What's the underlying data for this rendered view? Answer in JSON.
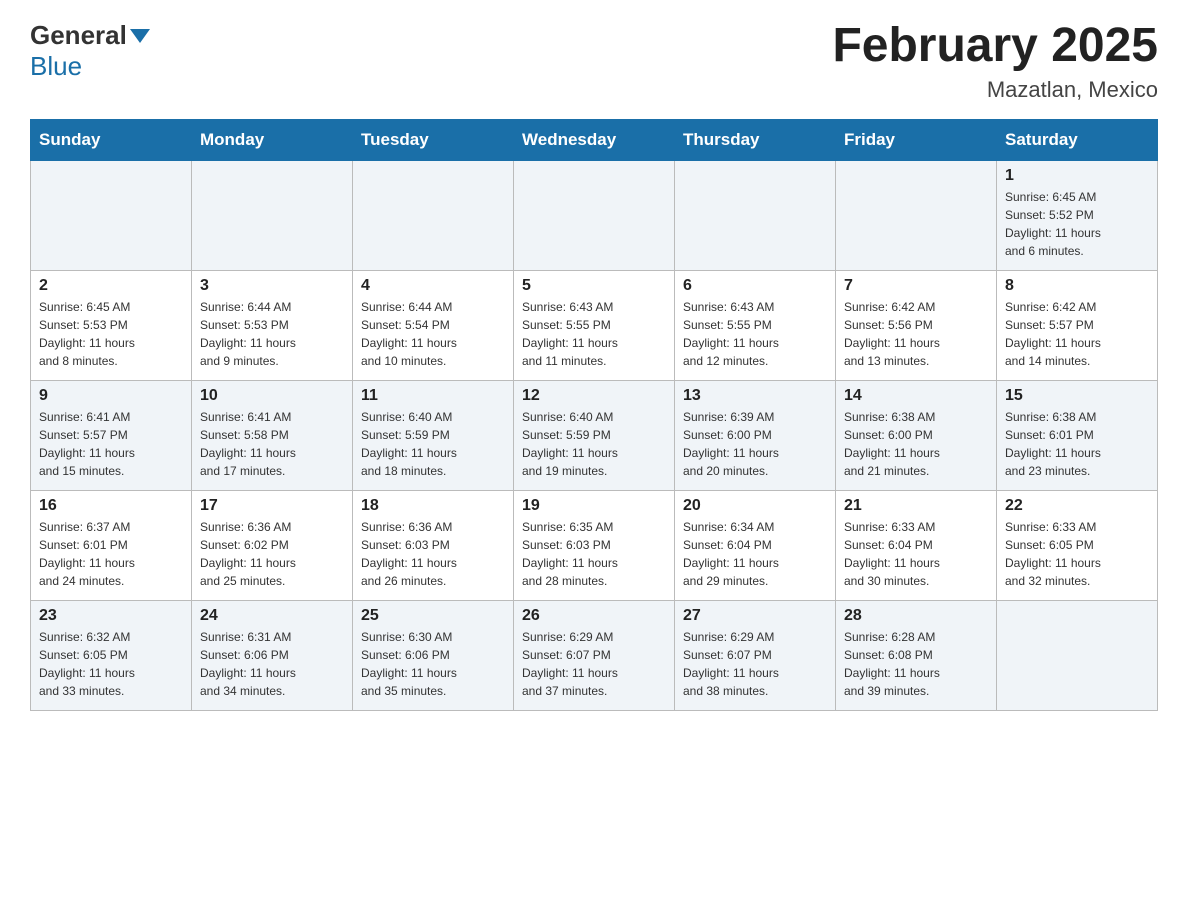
{
  "header": {
    "logo_general": "General",
    "logo_blue": "Blue",
    "month_title": "February 2025",
    "location": "Mazatlan, Mexico"
  },
  "days_of_week": [
    "Sunday",
    "Monday",
    "Tuesday",
    "Wednesday",
    "Thursday",
    "Friday",
    "Saturday"
  ],
  "weeks": [
    [
      {
        "day": "",
        "info": ""
      },
      {
        "day": "",
        "info": ""
      },
      {
        "day": "",
        "info": ""
      },
      {
        "day": "",
        "info": ""
      },
      {
        "day": "",
        "info": ""
      },
      {
        "day": "",
        "info": ""
      },
      {
        "day": "1",
        "info": "Sunrise: 6:45 AM\nSunset: 5:52 PM\nDaylight: 11 hours\nand 6 minutes."
      }
    ],
    [
      {
        "day": "2",
        "info": "Sunrise: 6:45 AM\nSunset: 5:53 PM\nDaylight: 11 hours\nand 8 minutes."
      },
      {
        "day": "3",
        "info": "Sunrise: 6:44 AM\nSunset: 5:53 PM\nDaylight: 11 hours\nand 9 minutes."
      },
      {
        "day": "4",
        "info": "Sunrise: 6:44 AM\nSunset: 5:54 PM\nDaylight: 11 hours\nand 10 minutes."
      },
      {
        "day": "5",
        "info": "Sunrise: 6:43 AM\nSunset: 5:55 PM\nDaylight: 11 hours\nand 11 minutes."
      },
      {
        "day": "6",
        "info": "Sunrise: 6:43 AM\nSunset: 5:55 PM\nDaylight: 11 hours\nand 12 minutes."
      },
      {
        "day": "7",
        "info": "Sunrise: 6:42 AM\nSunset: 5:56 PM\nDaylight: 11 hours\nand 13 minutes."
      },
      {
        "day": "8",
        "info": "Sunrise: 6:42 AM\nSunset: 5:57 PM\nDaylight: 11 hours\nand 14 minutes."
      }
    ],
    [
      {
        "day": "9",
        "info": "Sunrise: 6:41 AM\nSunset: 5:57 PM\nDaylight: 11 hours\nand 15 minutes."
      },
      {
        "day": "10",
        "info": "Sunrise: 6:41 AM\nSunset: 5:58 PM\nDaylight: 11 hours\nand 17 minutes."
      },
      {
        "day": "11",
        "info": "Sunrise: 6:40 AM\nSunset: 5:59 PM\nDaylight: 11 hours\nand 18 minutes."
      },
      {
        "day": "12",
        "info": "Sunrise: 6:40 AM\nSunset: 5:59 PM\nDaylight: 11 hours\nand 19 minutes."
      },
      {
        "day": "13",
        "info": "Sunrise: 6:39 AM\nSunset: 6:00 PM\nDaylight: 11 hours\nand 20 minutes."
      },
      {
        "day": "14",
        "info": "Sunrise: 6:38 AM\nSunset: 6:00 PM\nDaylight: 11 hours\nand 21 minutes."
      },
      {
        "day": "15",
        "info": "Sunrise: 6:38 AM\nSunset: 6:01 PM\nDaylight: 11 hours\nand 23 minutes."
      }
    ],
    [
      {
        "day": "16",
        "info": "Sunrise: 6:37 AM\nSunset: 6:01 PM\nDaylight: 11 hours\nand 24 minutes."
      },
      {
        "day": "17",
        "info": "Sunrise: 6:36 AM\nSunset: 6:02 PM\nDaylight: 11 hours\nand 25 minutes."
      },
      {
        "day": "18",
        "info": "Sunrise: 6:36 AM\nSunset: 6:03 PM\nDaylight: 11 hours\nand 26 minutes."
      },
      {
        "day": "19",
        "info": "Sunrise: 6:35 AM\nSunset: 6:03 PM\nDaylight: 11 hours\nand 28 minutes."
      },
      {
        "day": "20",
        "info": "Sunrise: 6:34 AM\nSunset: 6:04 PM\nDaylight: 11 hours\nand 29 minutes."
      },
      {
        "day": "21",
        "info": "Sunrise: 6:33 AM\nSunset: 6:04 PM\nDaylight: 11 hours\nand 30 minutes."
      },
      {
        "day": "22",
        "info": "Sunrise: 6:33 AM\nSunset: 6:05 PM\nDaylight: 11 hours\nand 32 minutes."
      }
    ],
    [
      {
        "day": "23",
        "info": "Sunrise: 6:32 AM\nSunset: 6:05 PM\nDaylight: 11 hours\nand 33 minutes."
      },
      {
        "day": "24",
        "info": "Sunrise: 6:31 AM\nSunset: 6:06 PM\nDaylight: 11 hours\nand 34 minutes."
      },
      {
        "day": "25",
        "info": "Sunrise: 6:30 AM\nSunset: 6:06 PM\nDaylight: 11 hours\nand 35 minutes."
      },
      {
        "day": "26",
        "info": "Sunrise: 6:29 AM\nSunset: 6:07 PM\nDaylight: 11 hours\nand 37 minutes."
      },
      {
        "day": "27",
        "info": "Sunrise: 6:29 AM\nSunset: 6:07 PM\nDaylight: 11 hours\nand 38 minutes."
      },
      {
        "day": "28",
        "info": "Sunrise: 6:28 AM\nSunset: 6:08 PM\nDaylight: 11 hours\nand 39 minutes."
      },
      {
        "day": "",
        "info": ""
      }
    ]
  ]
}
